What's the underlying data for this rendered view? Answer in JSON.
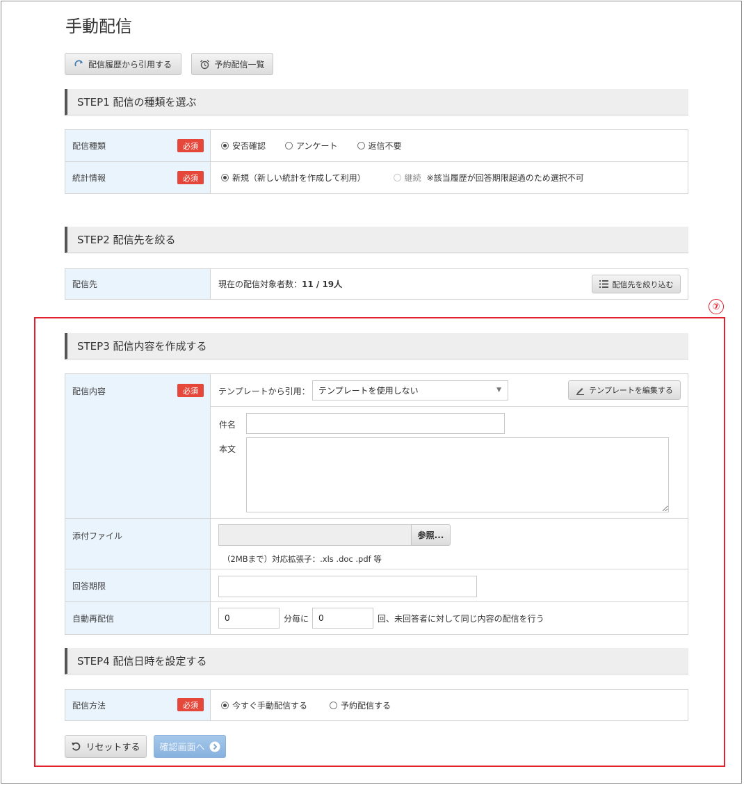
{
  "page": {
    "title": "手動配信"
  },
  "toolbar": {
    "history_label": "配信履歴から引用する",
    "scheduled_label": "予約配信一覧"
  },
  "step1": {
    "title": "STEP1 配信の種類を選ぶ",
    "required": "必須",
    "type_label": "配信種類",
    "type_options": [
      "安否確認",
      "アンケート",
      "返信不要"
    ],
    "stats_label": "統計情報",
    "stats_new": "新規（新しい統計を作成して利用）",
    "stats_continue": "継続",
    "stats_note": "※該当履歴が回答期限超過のため選択不可"
  },
  "step2": {
    "title": "STEP2 配信先を絞る",
    "target_label": "配信先",
    "count_prefix": "現在の配信対象者数：",
    "count_value": "11 / 19人",
    "filter_button": "配信先を絞り込む"
  },
  "marker": "⑦",
  "step3": {
    "title": "STEP3 配信内容を作成する",
    "content_label": "配信内容",
    "template_prefix": "テンプレートから引用：",
    "template_selected": "テンプレートを使用しない",
    "edit_template_button": "テンプレートを編集する",
    "subject_label": "件名",
    "subject_value": "",
    "body_label": "本文",
    "body_value": "",
    "attachment_label": "添付ファイル",
    "browse_button": "参照...",
    "attachment_note": "（2MBまで）対応拡張子：.xls .doc .pdf 等",
    "deadline_label": "回答期限",
    "deadline_value": "",
    "auto_label": "自動再配信",
    "auto_minutes": "0",
    "auto_every": "分毎に",
    "auto_times": "0",
    "auto_suffix": "回、未回答者に対して同じ内容の配信を行う"
  },
  "step4": {
    "title": "STEP4 配信日時を設定する",
    "method_label": "配信方法",
    "method_options": [
      "今すぐ手動配信する",
      "予約配信する"
    ]
  },
  "footer": {
    "reset_label": "リセットする",
    "confirm_label": "確認画面へ"
  }
}
